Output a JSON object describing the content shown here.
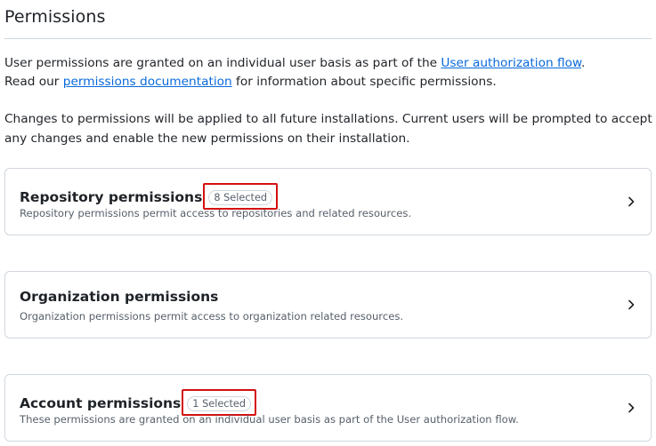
{
  "page": {
    "title": "Permissions"
  },
  "intro": {
    "line1_prefix": "User permissions are granted on an individual user basis as part of the ",
    "line1_link": "User authorization flow",
    "line1_suffix": ".",
    "line2_prefix": "Read our ",
    "line2_link": "permissions documentation",
    "line2_suffix": " for information about specific permissions."
  },
  "note": {
    "text": "Changes to permissions will be applied to all future installations. Current users will be prompted to accept any changes and enable the new permissions on their installation."
  },
  "cards": [
    {
      "title": "Repository permissions",
      "badge": "8 Selected",
      "description": "Repository permissions permit access to repositories and related resources.",
      "icon": "chevron-right-icon"
    },
    {
      "title": "Organization permissions",
      "badge": "",
      "description": "Organization permissions permit access to organization related resources.",
      "icon": "chevron-right-icon"
    },
    {
      "title": "Account permissions",
      "badge": "1 Selected",
      "description": "These permissions are granted on an individual user basis as part of the User authorization flow.",
      "icon": "chevron-right-icon"
    }
  ],
  "colors": {
    "link": "#0969da",
    "border": "#d0d7de",
    "highlight": "#d41010",
    "muted_text": "#57606a"
  }
}
